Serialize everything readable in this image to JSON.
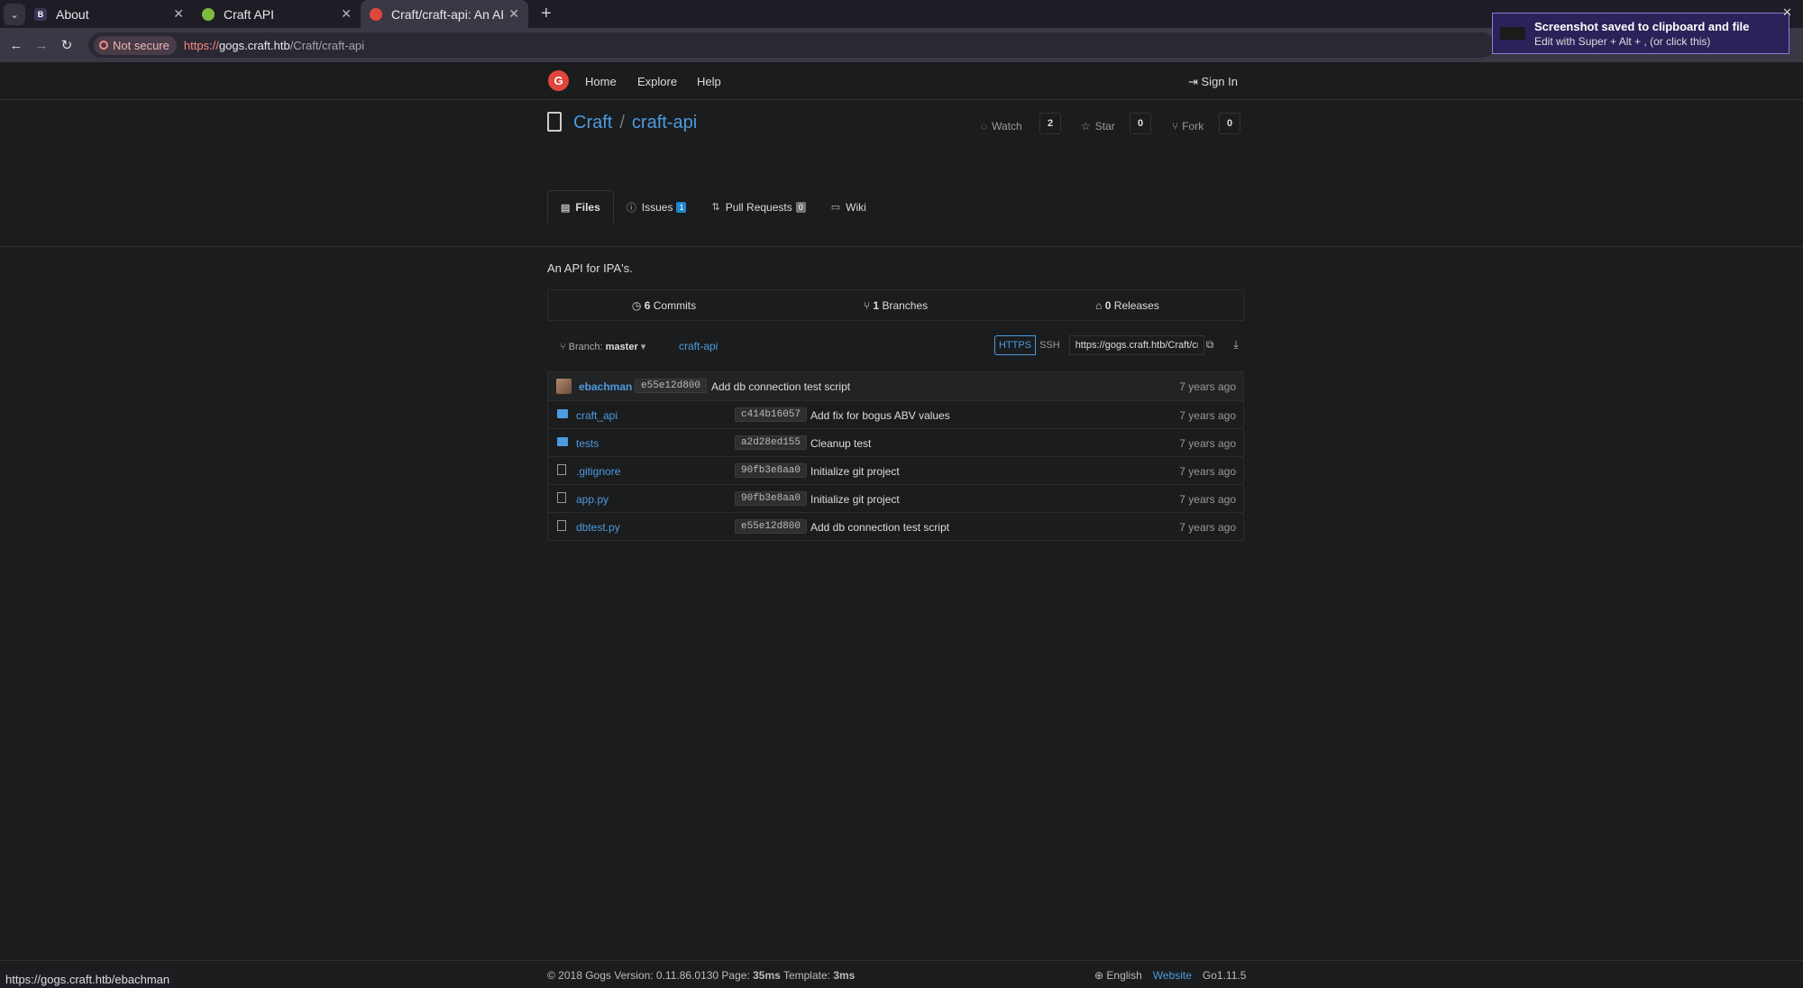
{
  "browser": {
    "tabs": [
      {
        "title": "About",
        "fav": "B",
        "fav_color": "#3a3458"
      },
      {
        "title": "Craft API",
        "fav": "",
        "fav_color": "#7dbb3f"
      },
      {
        "title": "Craft/craft-api: An API f",
        "fav": "",
        "fav_color": "#e0473c"
      }
    ],
    "not_secure": "Not secure",
    "url_proto": "https://",
    "url_host": "gogs.craft.htb",
    "url_path": "/Craft/craft-api"
  },
  "notification": {
    "title": "Screenshot saved to clipboard and file",
    "subtitle": "Edit with Super + Alt + , (or click this)"
  },
  "nav": {
    "home": "Home",
    "explore": "Explore",
    "help": "Help",
    "signin": "Sign In",
    "logo": "G"
  },
  "repo": {
    "owner": "Craft",
    "sep": "/",
    "name": "craft-api",
    "watch": "Watch",
    "watch_count": "2",
    "star": "Star",
    "star_count": "0",
    "fork": "Fork",
    "fork_count": "0",
    "tabs": {
      "files": "Files",
      "issues": "Issues",
      "issues_count": "1",
      "pulls": "Pull Requests",
      "pulls_count": "0",
      "wiki": "Wiki"
    },
    "description": "An API for IPA's.",
    "stats": {
      "commits_n": "6",
      "commits": "Commits",
      "branches_n": "1",
      "branches": "Branches",
      "releases_n": "0",
      "releases": "Releases"
    },
    "branch_label": "Branch:",
    "branch": "master",
    "crumb": "craft-api",
    "clone_https": "HTTPS",
    "clone_ssh": "SSH",
    "clone_url": "https://gogs.craft.htb/Craft/craft-api.git"
  },
  "latest_commit": {
    "author": "ebachman",
    "sha": "e55e12d800",
    "message": "Add db connection test script",
    "age": "7 years ago"
  },
  "files": [
    {
      "name": "craft_api",
      "type": "folder",
      "sha": "c414b16057",
      "message": "Add fix for bogus ABV values",
      "age": "7 years ago"
    },
    {
      "name": "tests",
      "type": "folder",
      "sha": "a2d28ed155",
      "message": "Cleanup test",
      "age": "7 years ago"
    },
    {
      "name": ".gitignore",
      "type": "file",
      "sha": "90fb3e8aa0",
      "message": "Initialize git project",
      "age": "7 years ago"
    },
    {
      "name": "app.py",
      "type": "file",
      "sha": "90fb3e8aa0",
      "message": "Initialize git project",
      "age": "7 years ago"
    },
    {
      "name": "dbtest.py",
      "type": "file",
      "sha": "e55e12d800",
      "message": "Add db connection test script",
      "age": "7 years ago"
    }
  ],
  "footer": {
    "copyright": "© 2018 Gogs Version: 0.11.86.0130 Page: ",
    "page_time": "35ms",
    "template_label": " Template: ",
    "template_time": "3ms",
    "language": "English",
    "website": "Website",
    "go_version": "Go1.11.5"
  },
  "status_url": "https://gogs.craft.htb/ebachman"
}
